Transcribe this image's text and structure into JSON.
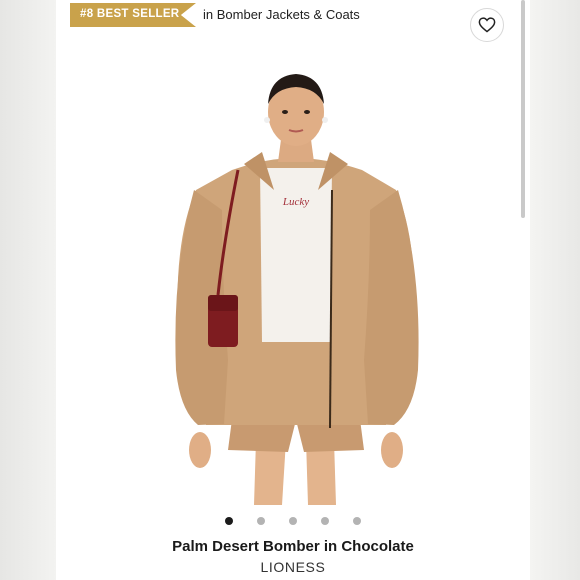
{
  "badge": {
    "text": "#8 BEST SELLER",
    "color": "#c9a24b"
  },
  "category": "in Bomber Jackets & Coats",
  "favorite": {
    "icon": "heart-icon"
  },
  "image": {
    "shirt_text": "Lucky",
    "active_index": 0,
    "total": 5
  },
  "product": {
    "title": "Palm Desert Bomber in Chocolate",
    "brand": "LIONESS"
  },
  "colors": {
    "jacket": "#cfa57a",
    "bag": "#7e1c20"
  }
}
